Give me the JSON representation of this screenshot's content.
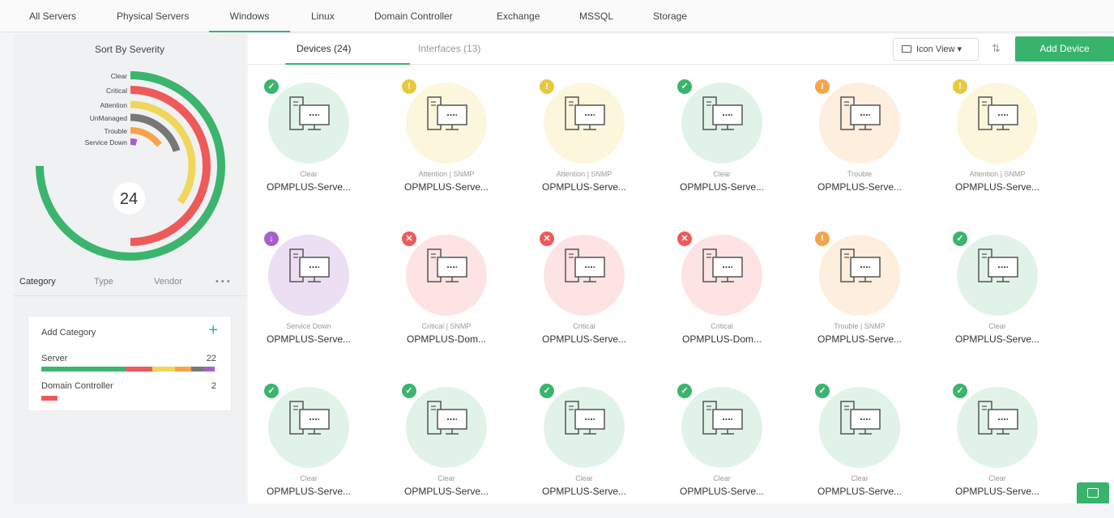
{
  "topnav": {
    "tabs": [
      "All Servers",
      "Physical Servers",
      "Windows",
      "Linux",
      "Domain Controller",
      "Exchange",
      "MSSQL",
      "Storage"
    ],
    "active": "Windows"
  },
  "severity": {
    "title": "Sort By Severity",
    "total": "24",
    "legend": [
      {
        "label": "Clear",
        "color": "#3bb56d",
        "fraction": 0.75
      },
      {
        "label": "Critical",
        "color": "#ee5a5a",
        "fraction": 0.5
      },
      {
        "label": "Attention",
        "color": "#f0d65a",
        "fraction": 0.35
      },
      {
        "label": "UnManaged",
        "color": "#777777",
        "fraction": 0.2
      },
      {
        "label": "Trouble",
        "color": "#f6a44c",
        "fraction": 0.15
      },
      {
        "label": "Service Down",
        "color": "#a660cc",
        "fraction": 0.04
      }
    ]
  },
  "category_tabs": {
    "category": "Category",
    "type": "Type",
    "vendor": "Vendor",
    "more": "• • •"
  },
  "category_card": {
    "add_label": "Add Category",
    "plus": "+",
    "rows": [
      {
        "label": "Server",
        "count": "22"
      },
      {
        "label": "Domain Controller",
        "count": "2"
      }
    ]
  },
  "subtabs": {
    "devices": "Devices (24)",
    "interfaces": "Interfaces (13)"
  },
  "toolbar": {
    "view_label": "Icon View ▾",
    "sort_icon": "⇅",
    "add_device": "Add Device"
  },
  "status_colors": {
    "Clear": {
      "bg": "#e1f3e8",
      "badge": "#3bb56d",
      "glyph": "✓"
    },
    "Attention": {
      "bg": "#fcf7dc",
      "badge": "#e8c93d",
      "glyph": "!"
    },
    "Trouble": {
      "bg": "#fdeede",
      "badge": "#f6a44c",
      "glyph": "!"
    },
    "Critical": {
      "bg": "#fde3e3",
      "badge": "#ee5a5a",
      "glyph": "✕"
    },
    "Service Down": {
      "bg": "#ecdff4",
      "badge": "#a660cc",
      "glyph": "↓"
    }
  },
  "devices": [
    {
      "name": "OPMPLUS-Serve...",
      "status_text": "Clear",
      "status": "Clear"
    },
    {
      "name": "OPMPLUS-Serve...",
      "status_text": "Attention | SNMP",
      "status": "Attention"
    },
    {
      "name": "OPMPLUS-Serve...",
      "status_text": "Attention | SNMP",
      "status": "Attention"
    },
    {
      "name": "OPMPLUS-Serve...",
      "status_text": "Clear",
      "status": "Clear"
    },
    {
      "name": "OPMPLUS-Serve...",
      "status_text": "Trouble",
      "status": "Trouble"
    },
    {
      "name": "OPMPLUS-Serve...",
      "status_text": "Attention | SNMP",
      "status": "Attention"
    },
    {
      "name": "OPMPLUS-Serve...",
      "status_text": "Service Down",
      "status": "Service Down"
    },
    {
      "name": "OPMPLUS-Dom...",
      "status_text": "Critical | SNMP",
      "status": "Critical"
    },
    {
      "name": "OPMPLUS-Serve...",
      "status_text": "Critical",
      "status": "Critical"
    },
    {
      "name": "OPMPLUS-Dom...",
      "status_text": "Critical",
      "status": "Critical"
    },
    {
      "name": "OPMPLUS-Serve...",
      "status_text": "Trouble | SNMP",
      "status": "Trouble"
    },
    {
      "name": "OPMPLUS-Serve...",
      "status_text": "Clear",
      "status": "Clear"
    },
    {
      "name": "OPMPLUS-Serve...",
      "status_text": "Clear",
      "status": "Clear"
    },
    {
      "name": "OPMPLUS-Serve...",
      "status_text": "Clear",
      "status": "Clear"
    },
    {
      "name": "OPMPLUS-Serve...",
      "status_text": "Clear",
      "status": "Clear"
    },
    {
      "name": "OPMPLUS-Serve...",
      "status_text": "Clear",
      "status": "Clear"
    },
    {
      "name": "OPMPLUS-Serve...",
      "status_text": "Clear",
      "status": "Clear"
    },
    {
      "name": "OPMPLUS-Serve...",
      "status_text": "Clear",
      "status": "Clear"
    }
  ]
}
